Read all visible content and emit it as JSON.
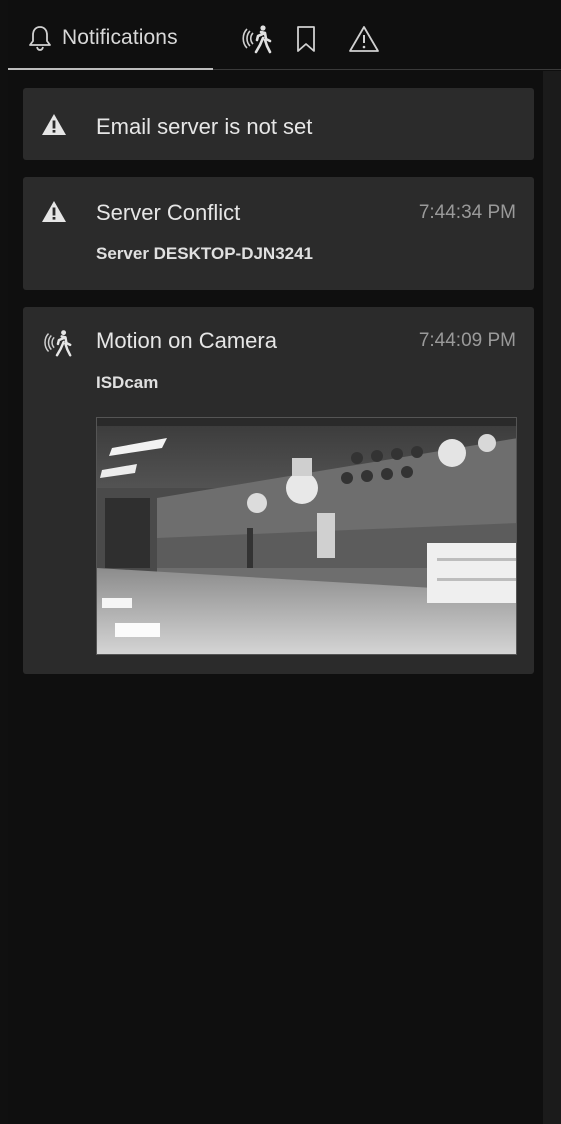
{
  "tabs": {
    "notifications_label": "Notifications"
  },
  "notifications": [
    {
      "type": "warning",
      "title": "Email server is not set"
    },
    {
      "type": "warning",
      "title": "Server Conflict",
      "time": "7:44:34 PM",
      "subtitle": "Server DESKTOP-DJN3241"
    },
    {
      "type": "motion",
      "title": "Motion on Camera",
      "time": "7:44:09 PM",
      "subtitle": "ISDcam"
    }
  ],
  "icons": {
    "tab_notifications": "bell-icon",
    "tab_motion": "motion-person-icon",
    "tab_bookmarks": "bookmark-icon",
    "tab_alerts": "warning-triangle-icon"
  },
  "colors": {
    "background": "#0f0f0f",
    "card": "#2b2b2b",
    "text_primary": "#e6e6e6",
    "text_secondary": "#9a9a9a"
  }
}
